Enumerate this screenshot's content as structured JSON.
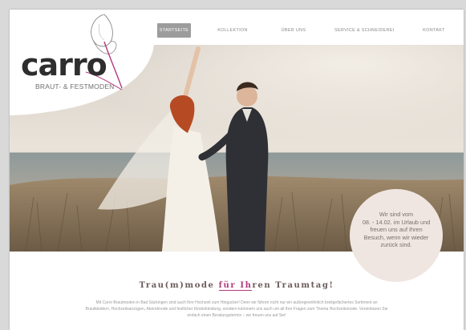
{
  "nav": {
    "items": [
      {
        "label": "STARTSEITE",
        "active": true
      },
      {
        "label": "KOLLEKTION",
        "active": false
      },
      {
        "label": "ÜBER UNS",
        "active": false
      },
      {
        "label": "SERVICE & SCHNEIDEREI",
        "active": false
      },
      {
        "label": "KONTAKT",
        "active": false
      }
    ]
  },
  "brand": {
    "name": "carro",
    "tagline": "BRAUT- & FESTMODEN",
    "accent_color": "#b23a7d"
  },
  "notice": {
    "lines": [
      "Wir sind vom",
      "08. - 14.02. im Urlaub und",
      "freuen uns auf Ihren",
      "Besuch, wenn wir wieder",
      "zurück sind."
    ]
  },
  "content": {
    "headline_start": "Trau(m)mode ",
    "headline_accent": "für Ih",
    "headline_end": "ren Traumtag!",
    "intro_lines": [
      "Mit Carro Brautmoden in Bad Säckingen sind auch Ihre Hochzeit zum Hingucker! Denn wir führen nicht nur ein außergewöhnlich breitgefächertes Sortiment an",
      "Brautkleidern, Hochzeitsanzügen, Abendmode und festlicher Kinderkleidung, sondern kümmern uns auch um all Ihre Fragen zum Thema Hochzeitsmode. Vereinbaren Sie",
      "einfach einen Beratungstermin – wir freuen uns auf Sie!"
    ]
  }
}
